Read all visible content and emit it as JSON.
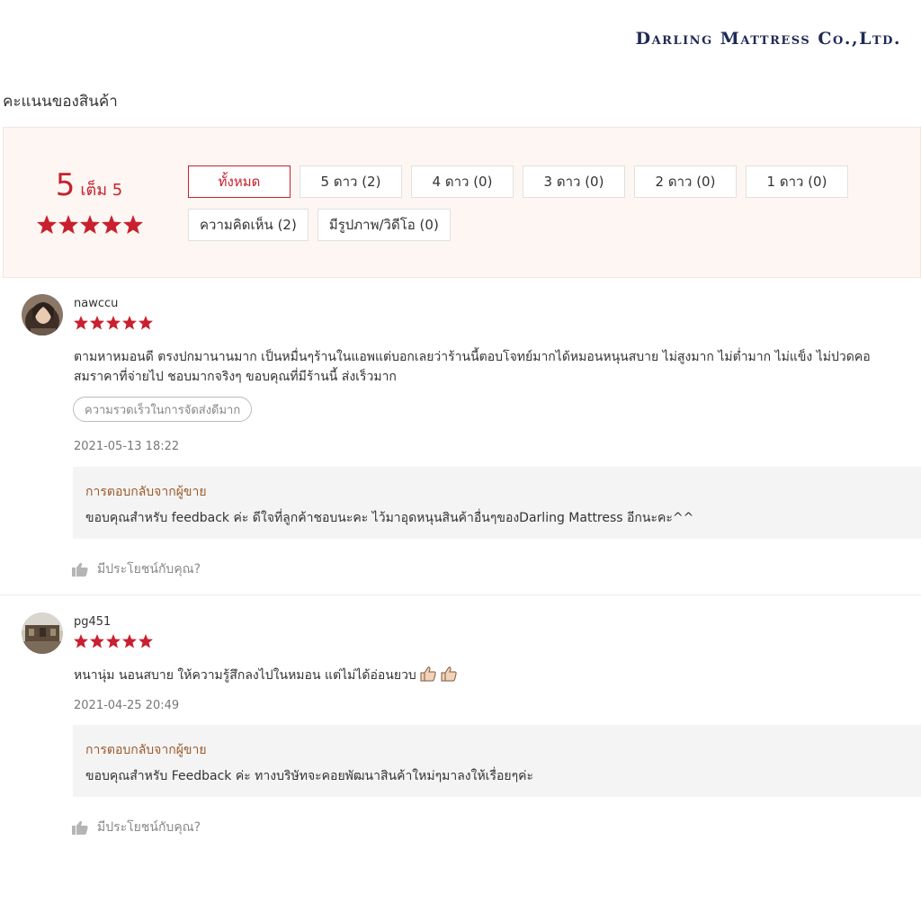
{
  "brand": "Darling Mattress Co.,Ltd.",
  "section_title": "คะแนนของสินค้า",
  "overview": {
    "score": "5",
    "score_suffix": "เต็ม 5",
    "stars": 5,
    "filters_row1": [
      "ทั้งหมด",
      "5 ดาว (2)",
      "4 ดาว (0)",
      "3 ดาว (0)",
      "2 ดาว (0)",
      "1 ดาว (0)"
    ],
    "filters_row2": [
      "ความคิดเห็น (2)",
      "มีรูปภาพ/วิดีโอ (0)"
    ],
    "active_filter": "ทั้งหมด"
  },
  "reviews": [
    {
      "username": "nawccu",
      "rating": 5,
      "comment_line1": "ตามหาหมอนดี ตรงปกมานานมาก เป็นหมื่นๆร้านในแอพแต่บอกเลยว่าร้านนี้ตอบโจทย์มากได้หมอนหนุนสบาย ไม่สูงมาก ไม่ต่ำมาก ไม่แข็ง ไม่ปวดคอ",
      "comment_line2": "สมราคาที่จ่ายไป ชอบมากจริงๆ ขอบคุณที่มีร้านนี้ ส่งเร็วมาก",
      "tag": "ความรวดเร็วในการจัดส่งดีมาก",
      "date": "2021-05-13 18:22",
      "reply_title": "การตอบกลับจากผู้ขาย",
      "reply_text": "ขอบคุณสำหรับ feedback ค่ะ ดีใจที่ลูกค้าชอบนะคะ ไว้มาอุดหนุนสินค้าอื่นๆของDarling Mattress อีกนะคะ^^",
      "helpful": "มีประโยชน์กับคุณ?"
    },
    {
      "username": "pg451",
      "rating": 5,
      "comment_line1": "หนานุ่ม นอนสบาย ให้ความรู้สึกลงไปในหมอน แต่ไม่ได้อ่อนยวบ",
      "date": "2021-04-25 20:49",
      "reply_title": "การตอบกลับจากผู้ขาย",
      "reply_text": "ขอบคุณสำหรับ Feedback ค่ะ ทางบริษัทจะคอยพัฒนาสินค้าใหม่ๆมาลงให้เรื่อยๆค่ะ",
      "helpful": "มีประโยชน์กับคุณ?"
    }
  ],
  "colors": {
    "accent": "#c8202f",
    "reply_title": "#9a5a2c",
    "brand": "#1f2a55",
    "panel_bg": "#fdf6f2"
  },
  "icons": [
    "star-icon",
    "thumbs-up-icon",
    "thumbs-up-emoji-icon",
    "avatar"
  ]
}
